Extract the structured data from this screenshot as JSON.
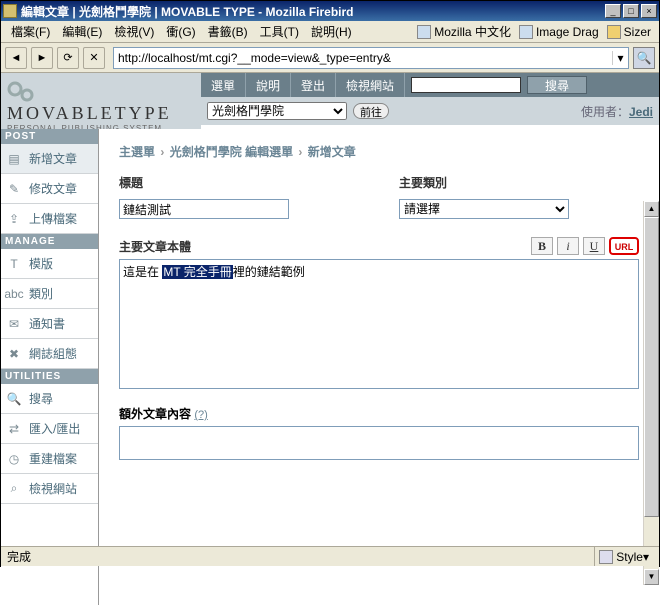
{
  "window": {
    "title": "編輯文章 | 光劍格鬥學院 | MOVABLE TYPE - Mozilla Firebird",
    "min": "_",
    "max": "□",
    "close": "×"
  },
  "menus": {
    "file": "檔案(F)",
    "edit": "編輯(E)",
    "view": "檢視(V)",
    "go": "衝(G)",
    "bookmarks": "書籤(B)",
    "tools": "工具(T)",
    "help": "說明(H)",
    "link1": "Mozilla 中文化",
    "link2": "Image Drag",
    "link3": "Sizer"
  },
  "nav": {
    "url": "http://localhost/mt.cgi?__mode=view&_type=entry&"
  },
  "mt": {
    "logo": "MOVABLETYPE",
    "sub": "PERSONAL PUBLISHING SYSTEM",
    "topnav": {
      "menu": "選單",
      "help": "說明",
      "logout": "登出",
      "viewsite": "檢視網站",
      "search_btn": "搜尋"
    },
    "blogselect": "光劍格鬥學院",
    "go": "前往",
    "user_label": "使用者：",
    "user": "Jedi"
  },
  "sidebar": {
    "post": "POST",
    "post_items": [
      "新增文章",
      "修改文章",
      "上傳檔案"
    ],
    "manage": "MANAGE",
    "manage_items": [
      "模版",
      "類別",
      "通知書",
      "網誌組態"
    ],
    "utilities": "UTILITIES",
    "util_items": [
      "搜尋",
      "匯入/匯出",
      "重建檔案",
      "檢視網站"
    ]
  },
  "breadcrumb": {
    "a": "主選單",
    "b": "光劍格鬥學院",
    "c": "編輯選單",
    "d": "新增文章",
    "sep": "›"
  },
  "form": {
    "title_label": "標題",
    "title_value": "鏈結測試",
    "cat_label": "主要類別",
    "cat_value": "請選擇",
    "body_label": "主要文章本體",
    "body_pre": "這是在 ",
    "body_sel": "MT 完全手冊",
    "body_post": "裡的鏈結範例",
    "fmt": {
      "b": "B",
      "i": "i",
      "u": "U",
      "url": "URL"
    },
    "ext_label": "額外文章內容",
    "ext_q": "(?)"
  },
  "status": {
    "done": "完成",
    "style": "Style",
    "dd": "▾"
  }
}
